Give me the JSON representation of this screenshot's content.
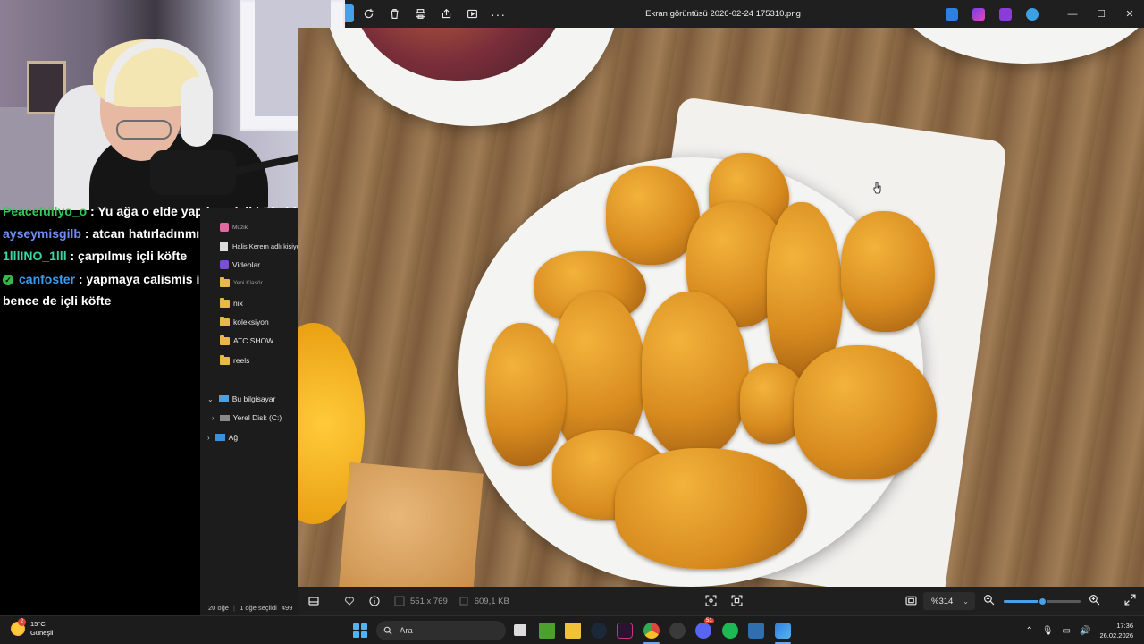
{
  "viewer": {
    "title": "Ekran görüntüsü 2026-02-24 175310.png",
    "toolbar_icons": [
      "rotate-icon",
      "delete-icon",
      "print-icon",
      "share-icon",
      "slideshow-icon",
      "more-icon"
    ],
    "window_controls": [
      "minimize-icon",
      "maximize-icon",
      "close-icon"
    ],
    "bottom": {
      "dimensions": "551 x 769",
      "file_size": "609,1 KB",
      "zoom": "%314",
      "zoom_level": 0.5
    }
  },
  "explorer": {
    "items": [
      {
        "label": "Müzik",
        "type": "music"
      },
      {
        "label": "Halis Kerem adlı kişiye",
        "type": "file"
      },
      {
        "label": "Videolar",
        "type": "video"
      },
      {
        "label": "Yeni Klasör",
        "type": "folder"
      },
      {
        "label": "nix",
        "type": "folder"
      },
      {
        "label": "koleksiyon",
        "type": "folder"
      },
      {
        "label": "ATC SHOW",
        "type": "folder"
      },
      {
        "label": "reels",
        "type": "folder"
      },
      {
        "label": "Bu bilgisayar",
        "type": "pc"
      },
      {
        "label": "Yerel Disk (C:)",
        "type": "disk"
      },
      {
        "label": "Ağ",
        "type": "network"
      }
    ],
    "status": {
      "count": "20 öğe",
      "selected": "1 öğe seçildi",
      "size": "499"
    }
  },
  "chat": {
    "messages": [
      {
        "user": "Peacefullyo_o",
        "color": "#35c85a",
        "text": ": Yu ağa o elde yapılmış içli köfteidir aq"
      },
      {
        "user": "ayseymisgilb",
        "color": "#6f8cf2",
        "text": ": atcan hatırladınmı beni @atcanbey"
      },
      {
        "user": "1lllINO_1lll",
        "color": "#3ad5a0",
        "text": ": çarpılmış içli köfte"
      },
      {
        "user": "canfoster",
        "color": "#3a9cf0",
        "text": ": yapmaya calismis ise yapamamis ama",
        "badge": true
      },
      {
        "user": "",
        "color": "#ffffff",
        "text": "bence de içli köfte"
      }
    ]
  },
  "taskbar": {
    "weather_temp": "15°C",
    "weather_desc": "Güneşli",
    "weather_badge": "2",
    "search_placeholder": "Ara",
    "time": "17:36",
    "date": "26.02.2026",
    "discord_badge": "51"
  }
}
